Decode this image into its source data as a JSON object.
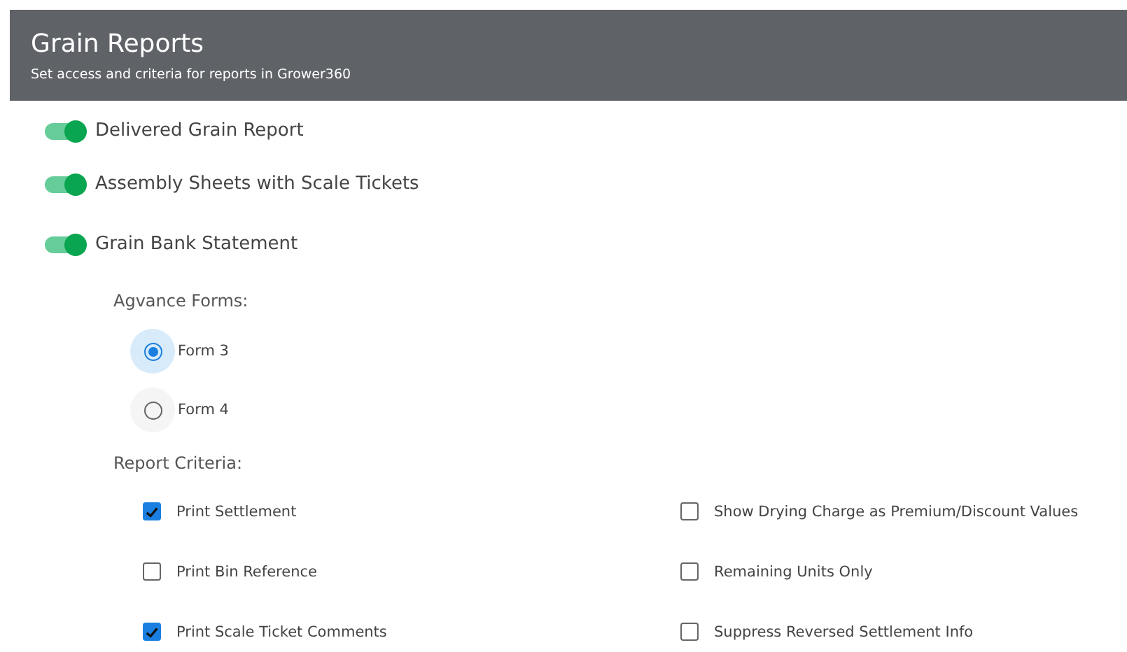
{
  "header": {
    "title": "Grain Reports",
    "subtitle": "Set access and criteria for reports in Grower360"
  },
  "reports": [
    {
      "label": "Delivered Grain Report",
      "on": true
    },
    {
      "label": "Assembly Sheets with Scale Tickets",
      "on": true
    },
    {
      "label": "Grain Bank Statement",
      "on": true
    }
  ],
  "forms": {
    "label": "Agvance Forms:",
    "options": [
      {
        "label": "Form 3",
        "selected": true
      },
      {
        "label": "Form 4",
        "selected": false
      }
    ]
  },
  "criteria": {
    "label": "Report Criteria:",
    "items": [
      {
        "label": "Print Settlement",
        "checked": true
      },
      {
        "label": "Show Drying Charge as Premium/Discount Values",
        "checked": false
      },
      {
        "label": "Print Bin Reference",
        "checked": false
      },
      {
        "label": "Remaining Units Only",
        "checked": false
      },
      {
        "label": "Print Scale Ticket Comments",
        "checked": true
      },
      {
        "label": "Suppress Reversed Settlement Info",
        "checked": false
      }
    ]
  }
}
